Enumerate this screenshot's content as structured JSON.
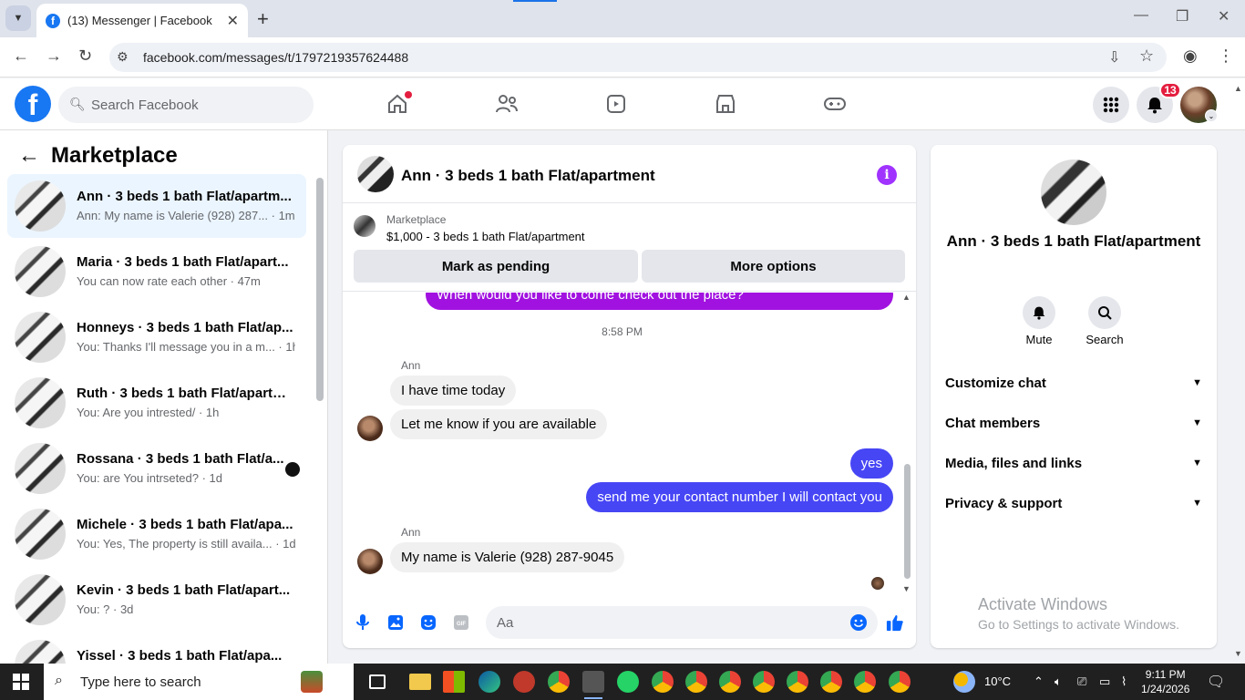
{
  "browser": {
    "tab_title": "(13) Messenger | Facebook",
    "url": "facebook.com/messages/t/1797219357624488"
  },
  "header": {
    "search_placeholder": "Search Facebook",
    "notification_count": "13"
  },
  "sidebar": {
    "title": "Marketplace",
    "conversations": [
      {
        "name": "Ann · 3 beds 1 bath Flat/apartm...",
        "preview": "Ann: My name is Valerie (928) 287... · 1m",
        "active": true
      },
      {
        "name": "Maria · 3 beds 1 bath Flat/apart...",
        "preview": "You can now rate each other · 47m"
      },
      {
        "name": "Honneys · 3 beds 1 bath Flat/ap...",
        "preview": "You: Thanks I'll message you in a m... · 1h"
      },
      {
        "name": "Ruth · 3 beds 1 bath Flat/apartm...",
        "preview": "You: Are you intrested/ · 1h"
      },
      {
        "name": "Rossana · 3 beds 1 bath Flat/a...",
        "preview": "You: are You intrseted? · 1d"
      },
      {
        "name": "Michele · 3 beds 1 bath Flat/apa...",
        "preview": "You: Yes, The property is still availa... · 1d"
      },
      {
        "name": "Kevin · 3 beds 1 bath Flat/apart...",
        "preview": "You: ? · 3d"
      },
      {
        "name": "Yissel · 3 beds 1 bath Flat/apa...",
        "preview": ""
      }
    ]
  },
  "chat": {
    "title": "Ann · 3 beds 1 bath Flat/apartment",
    "marketplace_label": "Marketplace",
    "listing": "$1,000 - 3 beds 1 bath Flat/apartment",
    "mark_pending": "Mark as pending",
    "more_options": "More options",
    "partial_message": "When would you like to come check out the place?",
    "timestamp": "8:58 PM",
    "sender_name": "Ann",
    "messages": [
      {
        "from": "in",
        "text": "I have time today"
      },
      {
        "from": "in",
        "text": "Let me know if you are available"
      },
      {
        "from": "out",
        "text": "yes"
      },
      {
        "from": "out",
        "text": "send me your contact number I will contact you"
      },
      {
        "from": "in",
        "text": "My name is Valerie  (928) 287-9045"
      }
    ],
    "compose_placeholder": "Aa"
  },
  "details": {
    "name": "Ann · 3 beds 1 bath Flat/apartment",
    "mute": "Mute",
    "search": "Search",
    "sections": [
      "Customize chat",
      "Chat members",
      "Media, files and links",
      "Privacy & support"
    ],
    "watermark_title": "Activate Windows",
    "watermark_sub": "Go to Settings to activate Windows."
  },
  "taskbar": {
    "search_placeholder": "Type here to search",
    "weather": "10°C",
    "time": "9:11 PM",
    "date": "1/24/2026"
  }
}
